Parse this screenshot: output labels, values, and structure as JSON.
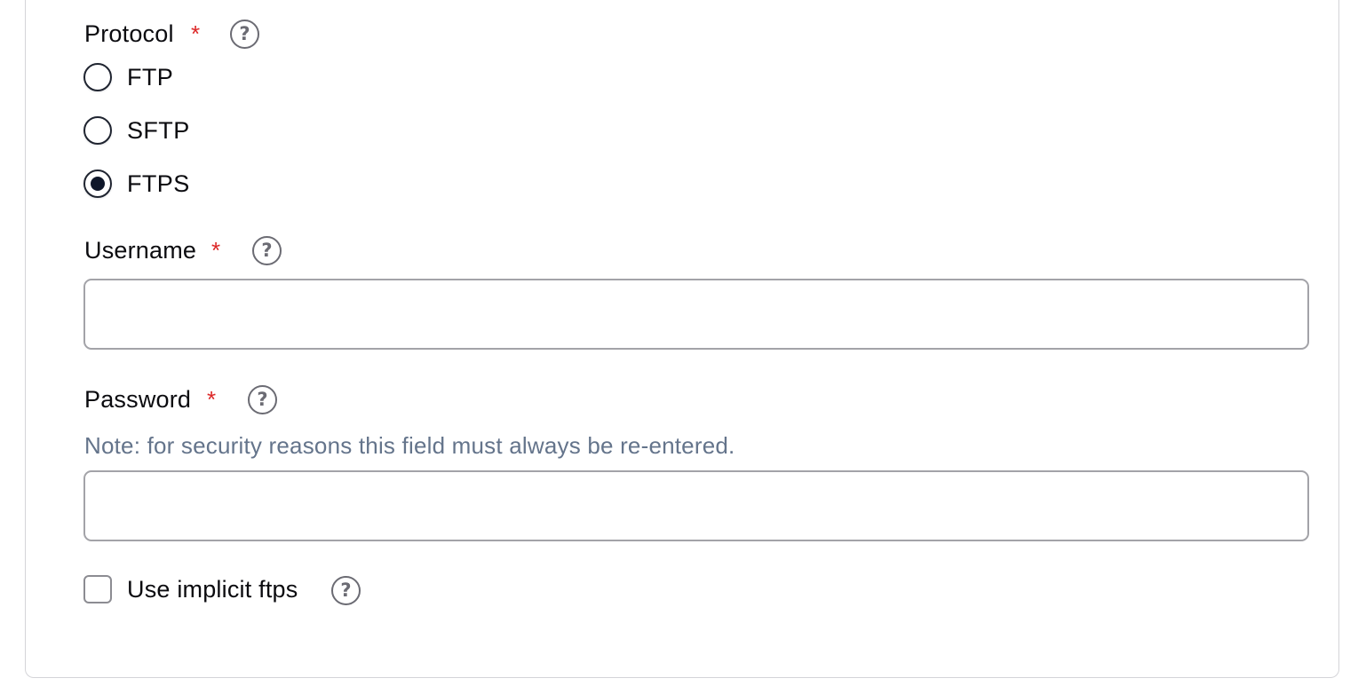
{
  "protocol": {
    "label": "Protocol",
    "required_mark": "*",
    "help_icon": "question-circle-icon",
    "options": [
      {
        "label": "FTP",
        "selected": false
      },
      {
        "label": "SFTP",
        "selected": false
      },
      {
        "label": "FTPS",
        "selected": true
      }
    ]
  },
  "username": {
    "label": "Username",
    "required_mark": "*",
    "help_icon": "question-circle-icon",
    "value": ""
  },
  "password": {
    "label": "Password",
    "required_mark": "*",
    "help_icon": "question-circle-icon",
    "note": "Note: for security reasons this field must always be re-entered.",
    "value": ""
  },
  "implicit_ftps": {
    "label": "Use implicit ftps",
    "checked": false,
    "help_icon": "question-circle-icon"
  },
  "help_glyph": "?",
  "colors": {
    "required": "#dc2626",
    "note": "#64748b",
    "border": "#a3a3a8",
    "radio_selected": "#0f172a"
  }
}
